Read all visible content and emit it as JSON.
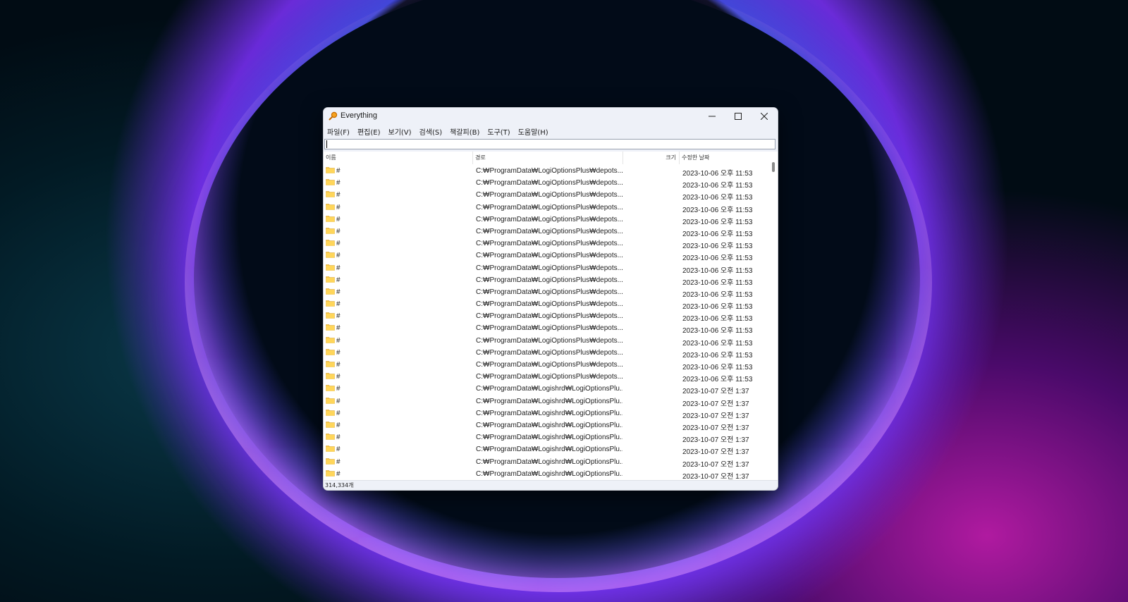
{
  "window": {
    "title": "Everything",
    "minimize": "—",
    "maximize": "☐",
    "close": "✕"
  },
  "menu": [
    {
      "label": "파일(F)"
    },
    {
      "label": "편집(E)"
    },
    {
      "label": "보기(V)"
    },
    {
      "label": "검색(S)"
    },
    {
      "label": "책갈피(B)"
    },
    {
      "label": "도구(T)"
    },
    {
      "label": "도움말(H)"
    }
  ],
  "search": {
    "value": ""
  },
  "columns": {
    "name": "이름",
    "path": "경로",
    "size": "크기",
    "date": "수정한 날짜"
  },
  "rows": [
    {
      "name": "#",
      "path": "C:₩ProgramData₩LogiOptionsPlus₩depots...",
      "date": "2023-10-06 오후 11:53"
    },
    {
      "name": "#",
      "path": "C:₩ProgramData₩LogiOptionsPlus₩depots...",
      "date": "2023-10-06 오후 11:53"
    },
    {
      "name": "#",
      "path": "C:₩ProgramData₩LogiOptionsPlus₩depots...",
      "date": "2023-10-06 오후 11:53"
    },
    {
      "name": "#",
      "path": "C:₩ProgramData₩LogiOptionsPlus₩depots...",
      "date": "2023-10-06 오후 11:53"
    },
    {
      "name": "#",
      "path": "C:₩ProgramData₩LogiOptionsPlus₩depots...",
      "date": "2023-10-06 오후 11:53"
    },
    {
      "name": "#",
      "path": "C:₩ProgramData₩LogiOptionsPlus₩depots...",
      "date": "2023-10-06 오후 11:53"
    },
    {
      "name": "#",
      "path": "C:₩ProgramData₩LogiOptionsPlus₩depots...",
      "date": "2023-10-06 오후 11:53"
    },
    {
      "name": "#",
      "path": "C:₩ProgramData₩LogiOptionsPlus₩depots...",
      "date": "2023-10-06 오후 11:53"
    },
    {
      "name": "#",
      "path": "C:₩ProgramData₩LogiOptionsPlus₩depots...",
      "date": "2023-10-06 오후 11:53"
    },
    {
      "name": "#",
      "path": "C:₩ProgramData₩LogiOptionsPlus₩depots...",
      "date": "2023-10-06 오후 11:53"
    },
    {
      "name": "#",
      "path": "C:₩ProgramData₩LogiOptionsPlus₩depots...",
      "date": "2023-10-06 오후 11:53"
    },
    {
      "name": "#",
      "path": "C:₩ProgramData₩LogiOptionsPlus₩depots...",
      "date": "2023-10-06 오후 11:53"
    },
    {
      "name": "#",
      "path": "C:₩ProgramData₩LogiOptionsPlus₩depots...",
      "date": "2023-10-06 오후 11:53"
    },
    {
      "name": "#",
      "path": "C:₩ProgramData₩LogiOptionsPlus₩depots...",
      "date": "2023-10-06 오후 11:53"
    },
    {
      "name": "#",
      "path": "C:₩ProgramData₩LogiOptionsPlus₩depots...",
      "date": "2023-10-06 오후 11:53"
    },
    {
      "name": "#",
      "path": "C:₩ProgramData₩LogiOptionsPlus₩depots...",
      "date": "2023-10-06 오후 11:53"
    },
    {
      "name": "#",
      "path": "C:₩ProgramData₩LogiOptionsPlus₩depots...",
      "date": "2023-10-06 오후 11:53"
    },
    {
      "name": "#",
      "path": "C:₩ProgramData₩LogiOptionsPlus₩depots...",
      "date": "2023-10-06 오후 11:53"
    },
    {
      "name": "#",
      "path": "C:₩ProgramData₩Logishrd₩LogiOptionsPlu...",
      "date": "2023-10-07 오전 1:37"
    },
    {
      "name": "#",
      "path": "C:₩ProgramData₩Logishrd₩LogiOptionsPlu...",
      "date": "2023-10-07 오전 1:37"
    },
    {
      "name": "#",
      "path": "C:₩ProgramData₩Logishrd₩LogiOptionsPlu...",
      "date": "2023-10-07 오전 1:37"
    },
    {
      "name": "#",
      "path": "C:₩ProgramData₩Logishrd₩LogiOptionsPlu...",
      "date": "2023-10-07 오전 1:37"
    },
    {
      "name": "#",
      "path": "C:₩ProgramData₩Logishrd₩LogiOptionsPlu...",
      "date": "2023-10-07 오전 1:37"
    },
    {
      "name": "#",
      "path": "C:₩ProgramData₩Logishrd₩LogiOptionsPlu...",
      "date": "2023-10-07 오전 1:37"
    },
    {
      "name": "#",
      "path": "C:₩ProgramData₩Logishrd₩LogiOptionsPlu...",
      "date": "2023-10-07 오전 1:37"
    },
    {
      "name": "#",
      "path": "C:₩ProgramData₩Logishrd₩LogiOptionsPlu...",
      "date": "2023-10-07 오전 1:37"
    }
  ],
  "status": {
    "count": "314,334개"
  },
  "colors": {
    "chrome": "#eef1f8",
    "folder": "#f5c242"
  }
}
